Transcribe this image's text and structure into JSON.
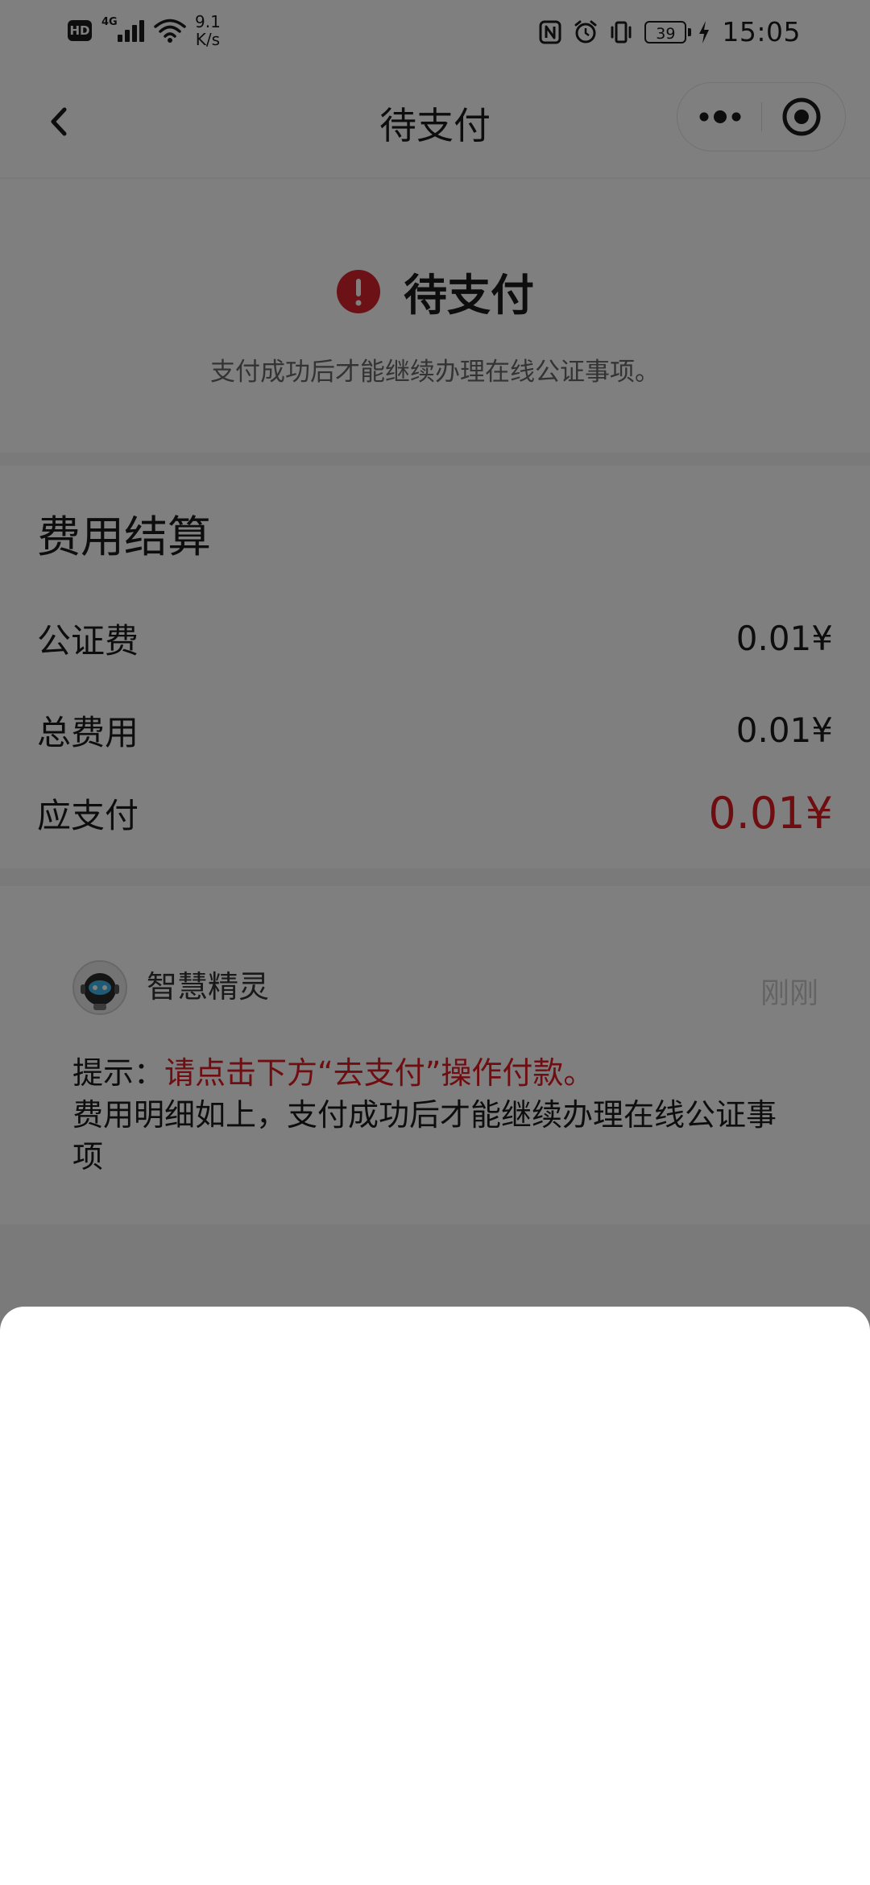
{
  "status_bar": {
    "hd_label": "HD",
    "network_label": "4G",
    "speed_value": "9.1",
    "speed_unit": "K/s",
    "battery_level": "39",
    "time": "15:05"
  },
  "nav": {
    "title": "待支付"
  },
  "payment_status": {
    "title": "待支付",
    "description": "支付成功后才能继续办理在线公证事项。",
    "alert_color": "#d8232a"
  },
  "fee_settlement": {
    "heading": "费用结算",
    "rows": [
      {
        "label": "公证费",
        "value": "0.01¥"
      },
      {
        "label": "总费用",
        "value": "0.01¥"
      },
      {
        "label": "应支付",
        "value": "0.01¥"
      }
    ],
    "due_color": "#e01b22"
  },
  "message": {
    "sender": "智慧精灵",
    "time": "刚刚",
    "hint_prefix": "提示：",
    "hint_highlight": "请点击下方“去支付”操作付款。",
    "body": "费用明细如上，支付成功后才能继续办理在线公证事项"
  }
}
